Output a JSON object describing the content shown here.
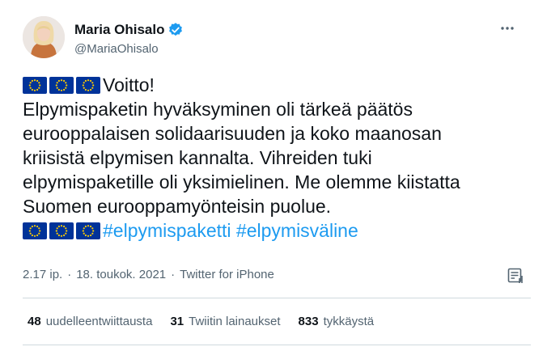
{
  "author": {
    "display_name": "Maria Ohisalo",
    "handle": "@MariaOhisalo",
    "verified": true
  },
  "icons": {
    "verified": "verified-badge-icon",
    "more": "more-options-icon",
    "analytics": "tweet-analytics-icon",
    "flag": "eu-flag-icon"
  },
  "tweet": {
    "line1": "Voitto!",
    "line2": "Elpymispaketin hyväksyminen oli tärkeä päätös",
    "line3": "eurooppalaisen solidaarisuuden ja koko maanosan",
    "line4": "kriisistä elpymisen kannalta. Vihreiden tuki",
    "line5": "elpymispaketille oli yksimielinen. Me olemme kiistatta",
    "line6": "Suomen eurooppamyönteisin puolue.",
    "hashtag1": "#elpymispaketti",
    "hashtag2": "#elpymisväline"
  },
  "meta": {
    "time": "2.17 ip.",
    "separator": "·",
    "date": "18. toukok. 2021",
    "source": "Twitter for iPhone"
  },
  "stats": {
    "retweets_count": "48",
    "retweets_label": "uudelleentwiittausta",
    "quotes_count": "31",
    "quotes_label": "Twiitin lainaukset",
    "likes_count": "833",
    "likes_label": "tykkäystä"
  },
  "colors": {
    "text": "#0f1419",
    "secondary": "#536471",
    "link": "#1d9bf0",
    "verified": "#1d9bf0",
    "eu_blue": "#003399",
    "eu_gold": "#ffcc00",
    "divider": "#cfd9de"
  }
}
